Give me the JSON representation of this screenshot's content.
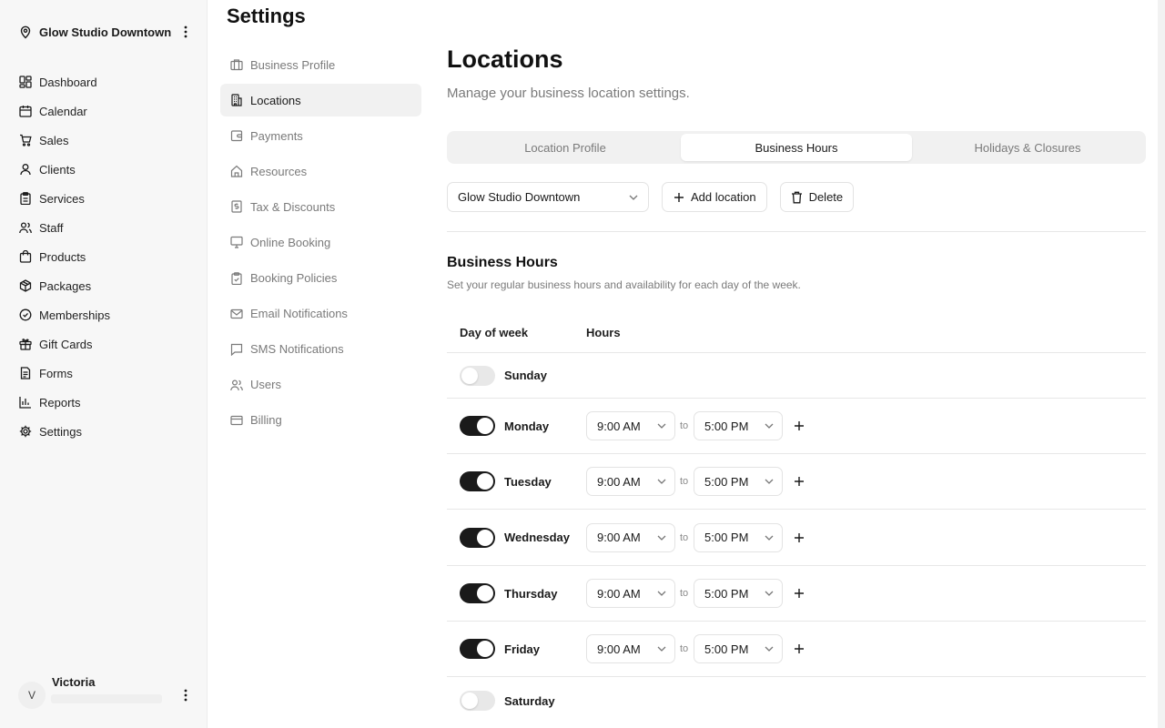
{
  "sidebar": {
    "location_name": "Glow Studio Downtown",
    "nav": [
      {
        "label": "Dashboard",
        "icon": "dashboard-icon"
      },
      {
        "label": "Calendar",
        "icon": "calendar-icon"
      },
      {
        "label": "Sales",
        "icon": "cart-icon"
      },
      {
        "label": "Clients",
        "icon": "user-icon"
      },
      {
        "label": "Services",
        "icon": "clipboard-icon"
      },
      {
        "label": "Staff",
        "icon": "users-icon"
      },
      {
        "label": "Products",
        "icon": "bag-icon"
      },
      {
        "label": "Packages",
        "icon": "package-icon"
      },
      {
        "label": "Memberships",
        "icon": "badge-check-icon"
      },
      {
        "label": "Gift Cards",
        "icon": "gift-icon"
      },
      {
        "label": "Forms",
        "icon": "form-icon"
      },
      {
        "label": "Reports",
        "icon": "bar-chart-icon"
      },
      {
        "label": "Settings",
        "icon": "gear-icon"
      }
    ],
    "user": {
      "initial": "V",
      "name": "Victoria"
    }
  },
  "settings": {
    "title": "Settings",
    "subnav": [
      {
        "label": "Business Profile",
        "icon": "briefcase-icon"
      },
      {
        "label": "Locations",
        "icon": "building-icon",
        "active": true
      },
      {
        "label": "Payments",
        "icon": "wallet-icon"
      },
      {
        "label": "Resources",
        "icon": "home-icon"
      },
      {
        "label": "Tax & Discounts",
        "icon": "receipt-icon"
      },
      {
        "label": "Online Booking",
        "icon": "monitor-icon"
      },
      {
        "label": "Booking Policies",
        "icon": "clipboard-check-icon"
      },
      {
        "label": "Email Notifications",
        "icon": "mail-icon"
      },
      {
        "label": "SMS Notifications",
        "icon": "message-icon"
      },
      {
        "label": "Users",
        "icon": "users-icon"
      },
      {
        "label": "Billing",
        "icon": "credit-card-icon"
      }
    ]
  },
  "main": {
    "title": "Locations",
    "subtitle": "Manage your business location settings.",
    "tabs": [
      {
        "label": "Location Profile",
        "active": false
      },
      {
        "label": "Business Hours",
        "active": true
      },
      {
        "label": "Holidays & Closures",
        "active": false
      }
    ],
    "location_select": "Glow Studio Downtown",
    "add_location_label": "Add location",
    "delete_label": "Delete",
    "section_title": "Business Hours",
    "section_subtitle": "Set your regular business hours and availability for each day of the week.",
    "col_day": "Day of week",
    "col_hours": "Hours",
    "to_label": "to",
    "days": [
      {
        "day": "Sunday",
        "enabled": false
      },
      {
        "day": "Monday",
        "enabled": true,
        "open": "9:00 AM",
        "close": "5:00 PM"
      },
      {
        "day": "Tuesday",
        "enabled": true,
        "open": "9:00 AM",
        "close": "5:00 PM"
      },
      {
        "day": "Wednesday",
        "enabled": true,
        "open": "9:00 AM",
        "close": "5:00 PM"
      },
      {
        "day": "Thursday",
        "enabled": true,
        "open": "9:00 AM",
        "close": "5:00 PM"
      },
      {
        "day": "Friday",
        "enabled": true,
        "open": "9:00 AM",
        "close": "5:00 PM"
      },
      {
        "day": "Saturday",
        "enabled": false
      }
    ]
  },
  "colors": {
    "accent": "#1a1a1a",
    "muted_text": "#7a7a7a",
    "border": "#e3e3e3",
    "sidebar_bg": "#f7f7f7"
  }
}
